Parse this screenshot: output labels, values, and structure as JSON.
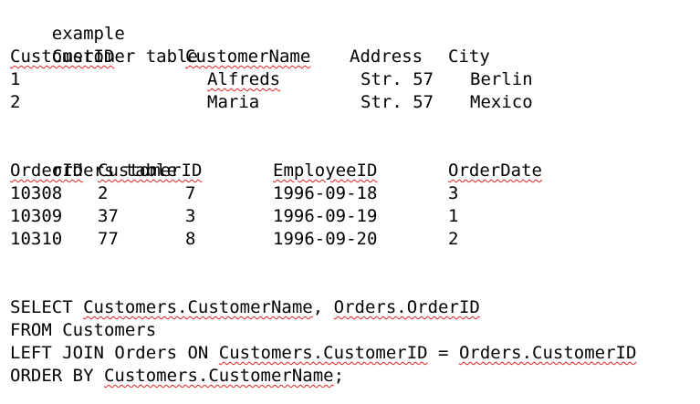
{
  "heading": "example",
  "customer_table": {
    "title": "Customer table",
    "headers": [
      "CustomerID",
      "CustomerName",
      "Address",
      "City"
    ],
    "rows": [
      [
        "1",
        "Alfreds",
        "Str. 57",
        "Berlin"
      ],
      [
        "2",
        "Maria",
        "Str. 57",
        "Mexico"
      ]
    ]
  },
  "orders_table": {
    "title": "orders table",
    "headers": [
      "OrderID",
      "CustomerID",
      "EmployeeID",
      "OrderDate"
    ],
    "rows": [
      [
        "10308",
        "2",
        "7",
        "1996-09-18",
        "3"
      ],
      [
        "10309",
        "37",
        "3",
        "1996-09-19",
        "1"
      ],
      [
        "10310",
        "77",
        "8",
        "1996-09-20",
        "2"
      ]
    ]
  },
  "query": {
    "select_kw": "SELECT",
    "select_col1": "Customers.CustomerName",
    "comma": ",",
    "select_col2": "Orders.OrderID",
    "from_line": "FROM Customers",
    "join_kw": "LEFT JOIN Orders ON",
    "join_left": "Customers.CustomerID",
    "equals": "=",
    "join_right": "Orders.CustomerID",
    "order_kw": "ORDER BY",
    "order_col": "Customers.CustomerName",
    "semicolon": ";"
  },
  "colors": {
    "text": "#000000",
    "spellcheck_underline": "#e02020",
    "background": "#ffffff"
  }
}
